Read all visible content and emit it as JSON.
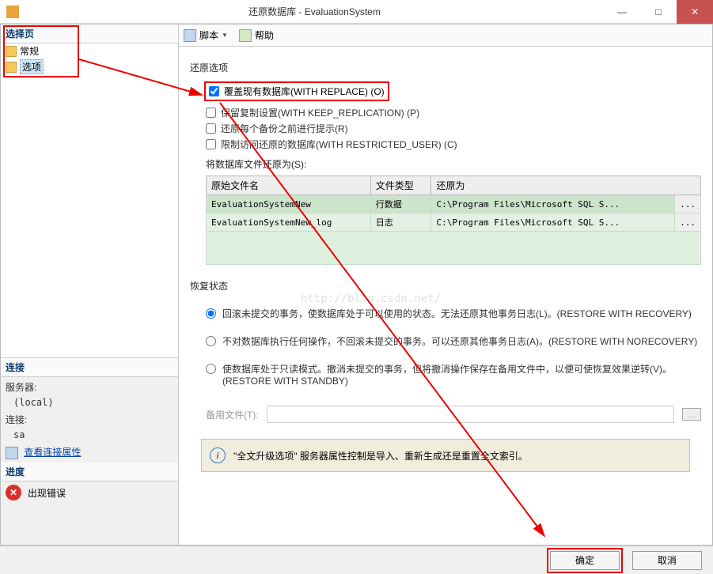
{
  "window": {
    "title": "还原数据库 - EvaluationSystem",
    "min": "—",
    "max": "□",
    "close": "✕"
  },
  "left": {
    "select_page": "选择页",
    "general": "常规",
    "options": "选项",
    "connection": "连接",
    "server_label": "服务器:",
    "server_val": "(local)",
    "conn_label": "连接:",
    "conn_val": "sa",
    "view_props": "查看连接属性",
    "progress": "进度",
    "error": "出现错误"
  },
  "toolbar": {
    "script": "脚本",
    "help": "帮助"
  },
  "restore_options": {
    "title": "还原选项",
    "overwrite": "覆盖现有数据库(WITH REPLACE) (O)",
    "keep_repl": "保留复制设置(WITH KEEP_REPLICATION) (P)",
    "prompt": "还原每个备份之前进行提示(R)",
    "restricted": "限制访问还原的数据库(WITH RESTRICTED_USER) (C)",
    "restore_as": "将数据库文件还原为(S):"
  },
  "files": {
    "col1": "原始文件名",
    "col2": "文件类型",
    "col3": "还原为",
    "rows": [
      {
        "name": "EvaluationSystemNew",
        "type": "行数据",
        "path": "C:\\Program Files\\Microsoft SQL S..."
      },
      {
        "name": "EvaluationSystemNew_log",
        "type": "日志",
        "path": "C:\\Program Files\\Microsoft SQL S..."
      }
    ],
    "browse": "..."
  },
  "recovery": {
    "title": "恢复状态",
    "r1": "回滚未提交的事务，使数据库处于可以使用的状态。无法还原其他事务日志(L)。(RESTORE WITH RECOVERY)",
    "r2": "不对数据库执行任何操作，不回滚未提交的事务。可以还原其他事务日志(A)。(RESTORE WITH NORECOVERY)",
    "r3": "使数据库处于只读模式。撤消未提交的事务，但将撤消操作保存在备用文件中，以便可使恢复效果逆转(V)。(RESTORE WITH STANDBY)",
    "backup_file": "备用文件(T):"
  },
  "info": "\"全文升级选项\" 服务器属性控制是导入、重新生成还是重置全文索引。",
  "footer": {
    "ok": "确定",
    "cancel": "取消"
  },
  "watermark": "http://blog.csdn.net/"
}
